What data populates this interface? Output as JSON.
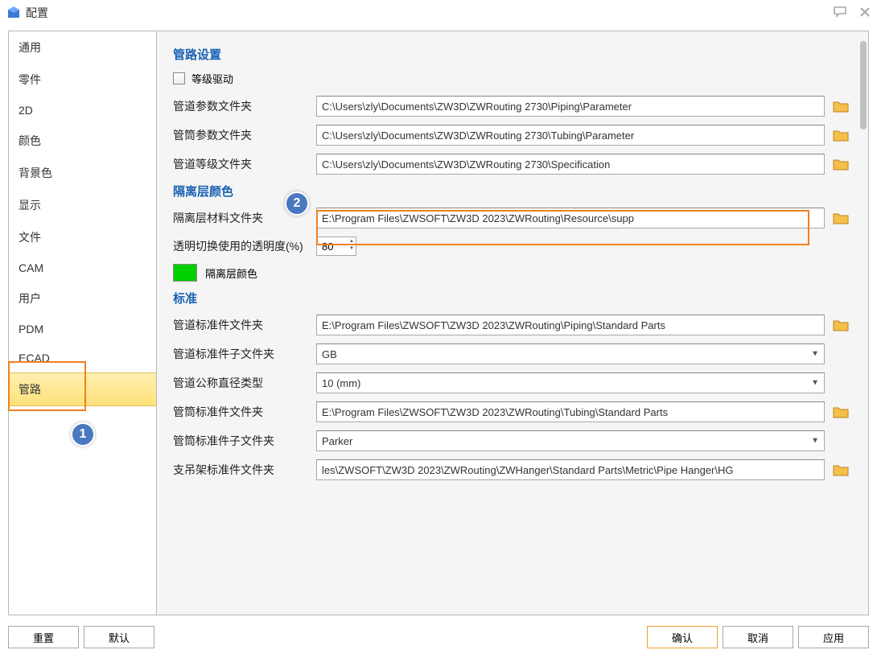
{
  "window": {
    "title": "配置"
  },
  "sidebar": {
    "items": [
      {
        "label": "通用"
      },
      {
        "label": "零件"
      },
      {
        "label": "2D"
      },
      {
        "label": "颜色"
      },
      {
        "label": "背景色"
      },
      {
        "label": "显示"
      },
      {
        "label": "文件"
      },
      {
        "label": "CAM"
      },
      {
        "label": "用户"
      },
      {
        "label": "PDM"
      },
      {
        "label": "ECAD"
      },
      {
        "label": "管路"
      }
    ]
  },
  "sections": {
    "s1_title": "管路设置",
    "s1_check_label": "等级驱动",
    "s1_r1_label": "管道参数文件夹",
    "s1_r1_value": "C:\\Users\\zly\\Documents\\ZW3D\\ZWRouting 2730\\Piping\\Parameter",
    "s1_r2_label": "管筒参数文件夹",
    "s1_r2_value": "C:\\Users\\zly\\Documents\\ZW3D\\ZWRouting 2730\\Tubing\\Parameter",
    "s1_r3_label": "管道等级文件夹",
    "s1_r3_value": "C:\\Users\\zly\\Documents\\ZW3D\\ZWRouting 2730\\Specification",
    "s2_title": "隔离层颜色",
    "s2_r1_label": "隔离层材料文件夹",
    "s2_r1_value": "E:\\Program Files\\ZWSOFT\\ZW3D 2023\\ZWRouting\\Resource\\supp",
    "s2_r2_label": "透明切换使用的透明度(%)",
    "s2_r2_value": "80",
    "s2_color_label": "隔离层颜色",
    "s3_title": "标准",
    "s3_r1_label": "管道标准件文件夹",
    "s3_r1_value": "E:\\Program Files\\ZWSOFT\\ZW3D 2023\\ZWRouting\\Piping\\Standard Parts",
    "s3_r2_label": "管道标准件子文件夹",
    "s3_r2_value": "GB",
    "s3_r3_label": "管道公称直径类型",
    "s3_r3_value": "10 (mm)",
    "s3_r4_label": "管筒标准件文件夹",
    "s3_r4_value": "E:\\Program Files\\ZWSOFT\\ZW3D 2023\\ZWRouting\\Tubing\\Standard Parts",
    "s3_r5_label": "管筒标准件子文件夹",
    "s3_r5_value": "Parker",
    "s3_r6_label": "支吊架标准件文件夹",
    "s3_r6_value": "les\\ZWSOFT\\ZW3D 2023\\ZWRouting\\ZWHanger\\Standard Parts\\Metric\\Pipe Hanger\\HG"
  },
  "footer": {
    "reset": "重置",
    "default": "默认",
    "ok": "确认",
    "cancel": "取消",
    "apply": "应用"
  },
  "badges": {
    "b1": "1",
    "b2": "2"
  }
}
